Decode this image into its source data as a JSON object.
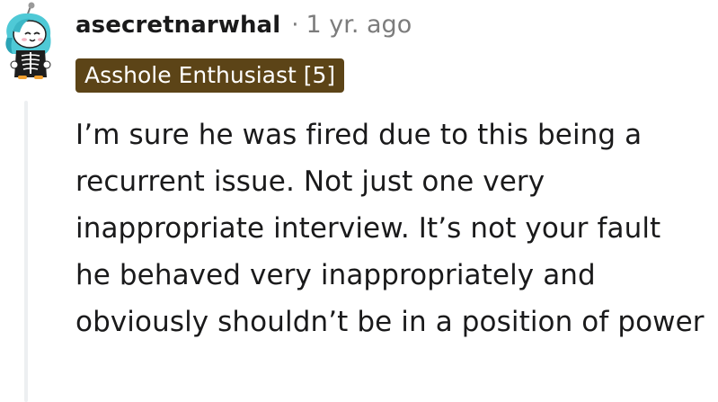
{
  "comment": {
    "username": "asecretnarwhal",
    "separator": "·",
    "time": "1 yr. ago",
    "flair": "Asshole Enthusiast [5]",
    "body": "I’m sure he was fired due to this being a recurrent issue. Not just one very inappropriate interview. It’s not your fault he behaved very inappropriately and obviously shouldn’t be in a position of power"
  },
  "colors": {
    "flair_bg": "#5c4417",
    "thread_line": "#edeff1",
    "meta_gray": "#7c7c7c",
    "avatar_hair": "#4fc9d6"
  },
  "icons": {
    "avatar": "snoo-avatar-icon"
  }
}
